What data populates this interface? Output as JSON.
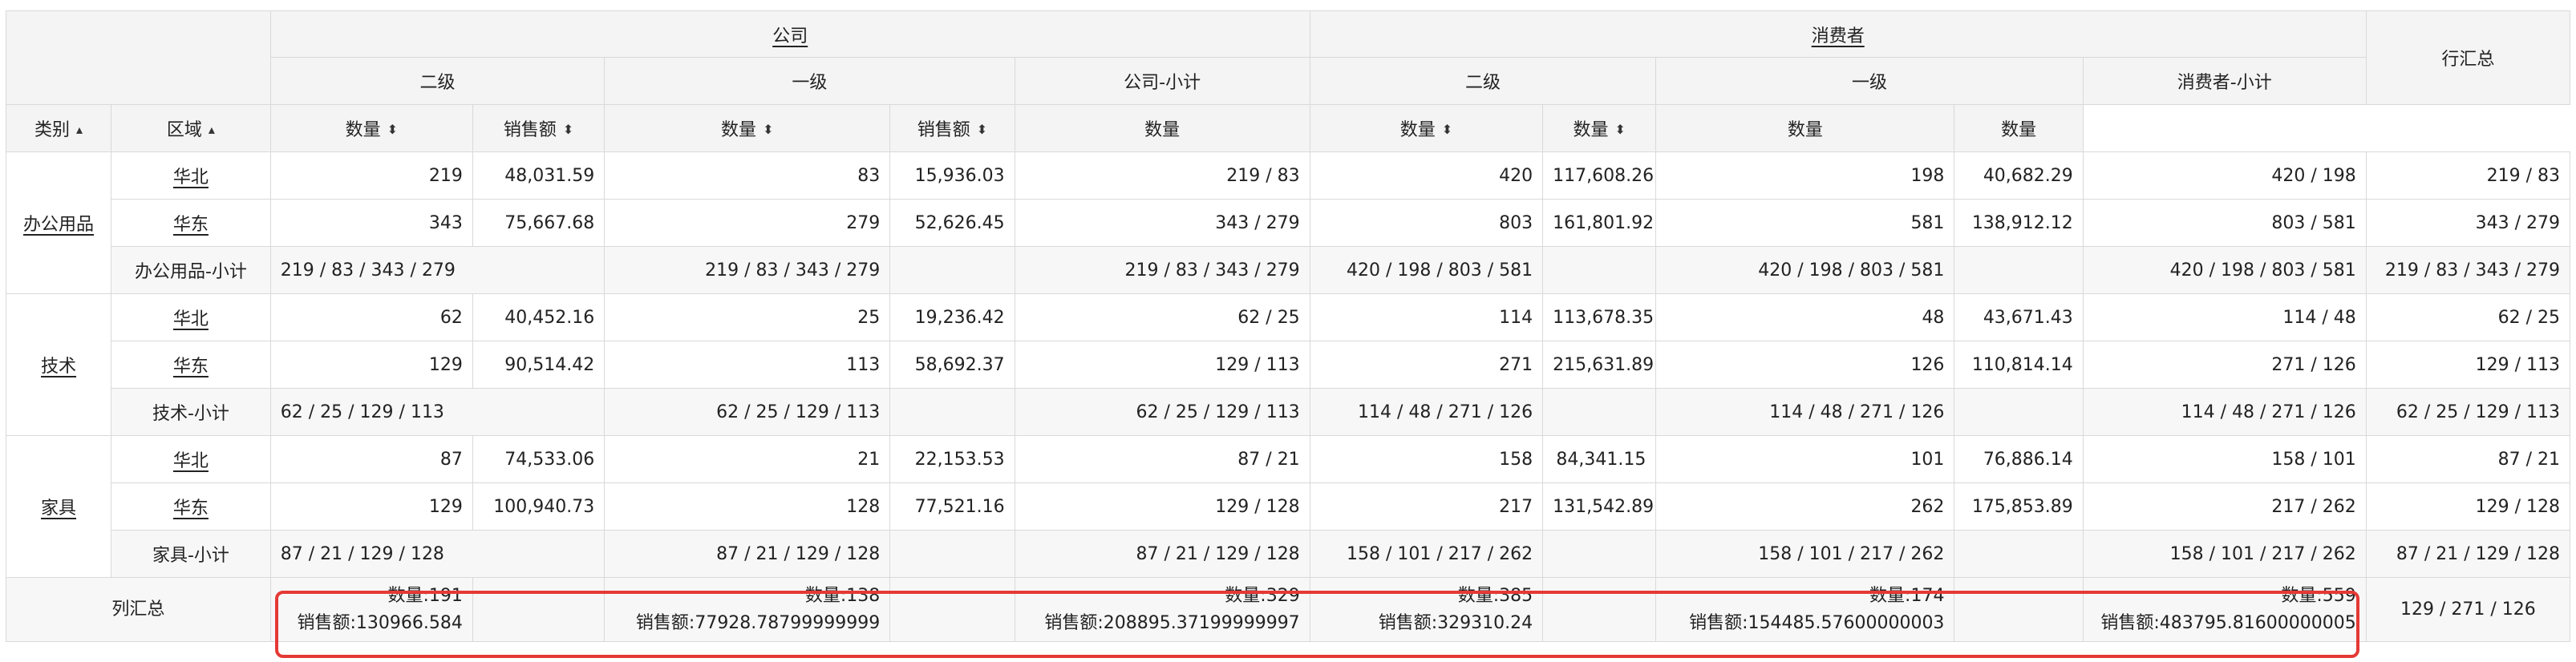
{
  "header": {
    "company": "公司",
    "consumer": "消费者",
    "row_total": "行汇总",
    "level2": "二级",
    "level1": "一级",
    "company_subtotal": "公司-小计",
    "consumer_subtotal": "消费者-小计",
    "qty": "数量",
    "sales": "销售额",
    "category": "类别",
    "region": "区域",
    "sort_both": "⬍",
    "sort_up": "▴"
  },
  "rows": {
    "office": {
      "label": "办公用品",
      "north": {
        "region": "华北",
        "c2q": "219",
        "c2s": "48,031.59",
        "c1q": "83",
        "c1s": "15,936.03",
        "csub": "219 / 83",
        "p2q": "420",
        "p2s": "117,608.26",
        "p1q": "198",
        "p1s": "40,682.29",
        "psub": "420 / 198",
        "total": "219 / 83"
      },
      "east": {
        "region": "华东",
        "c2q": "343",
        "c2s": "75,667.68",
        "c1q": "279",
        "c1s": "52,626.45",
        "csub": "343 / 279",
        "p2q": "803",
        "p2s": "161,801.92",
        "p1q": "581",
        "p1s": "138,912.12",
        "psub": "803 / 581",
        "total": "343 / 279"
      },
      "subtotal": {
        "label": "办公用品-小计",
        "c2": "219 / 83 / 343 / 279",
        "c1": "219 / 83 / 343 / 279",
        "csub": "219 / 83 / 343 / 279",
        "p2": "420 / 198 / 803 / 581",
        "p1": "420 / 198 / 803 / 581",
        "psub": "420 / 198 / 803 / 581",
        "total": "219 / 83 / 343 / 279"
      }
    },
    "tech": {
      "label": "技术",
      "north": {
        "region": "华北",
        "c2q": "62",
        "c2s": "40,452.16",
        "c1q": "25",
        "c1s": "19,236.42",
        "csub": "62 / 25",
        "p2q": "114",
        "p2s": "113,678.35",
        "p1q": "48",
        "p1s": "43,671.43",
        "psub": "114 / 48",
        "total": "62 / 25"
      },
      "east": {
        "region": "华东",
        "c2q": "129",
        "c2s": "90,514.42",
        "c1q": "113",
        "c1s": "58,692.37",
        "csub": "129 / 113",
        "p2q": "271",
        "p2s": "215,631.89",
        "p1q": "126",
        "p1s": "110,814.14",
        "psub": "271 / 126",
        "total": "129 / 113"
      },
      "subtotal": {
        "label": "技术-小计",
        "c2": "62 / 25 / 129 / 113",
        "c1": "62 / 25 / 129 / 113",
        "csub": "62 / 25 / 129 / 113",
        "p2": "114 / 48 / 271 / 126",
        "p1": "114 / 48 / 271 / 126",
        "psub": "114 / 48 / 271 / 126",
        "total": "62 / 25 / 129 / 113"
      }
    },
    "furniture": {
      "label": "家具",
      "north": {
        "region": "华北",
        "c2q": "87",
        "c2s": "74,533.06",
        "c1q": "21",
        "c1s": "22,153.53",
        "csub": "87 / 21",
        "p2q": "158",
        "p2s": "84,341.15",
        "p1q": "101",
        "p1s": "76,886.14",
        "psub": "158 / 101",
        "total": "87 / 21"
      },
      "east": {
        "region": "华东",
        "c2q": "129",
        "c2s": "100,940.73",
        "c1q": "128",
        "c1s": "77,521.16",
        "csub": "129 / 128",
        "p2q": "217",
        "p2s": "131,542.89",
        "p1q": "262",
        "p1s": "175,853.89",
        "psub": "217 / 262",
        "total": "129 / 128"
      },
      "subtotal": {
        "label": "家具-小计",
        "c2": "87 / 21 / 129 / 128",
        "c1": "87 / 21 / 129 / 128",
        "csub": "87 / 21 / 129 / 128",
        "p2": "158 / 101 / 217 / 262",
        "p1": "158 / 101 / 217 / 262",
        "psub": "158 / 101 / 217 / 262",
        "total": "87 / 21 / 129 / 128"
      }
    }
  },
  "grand": {
    "label": "列汇总",
    "c2_q": "数量:191",
    "c2_s": "销售额:130966.584",
    "c1_q": "数量:138",
    "c1_s": "销售额:77928.78799999999",
    "csub_q": "数量:329",
    "csub_s": "销售额:208895.37199999997",
    "p2_q": "数量:385",
    "p2_s": "销售额:329310.24",
    "p1_q": "数量:174",
    "p1_s": "销售额:154485.57600000003",
    "psub_q": "数量:559",
    "psub_s": "销售额:483795.81600000005",
    "total": "129 / 271 / 126"
  },
  "colors": {
    "header_bg": "#f4f4f5",
    "grid": "#d9d9d9",
    "highlight": "#e53935"
  }
}
